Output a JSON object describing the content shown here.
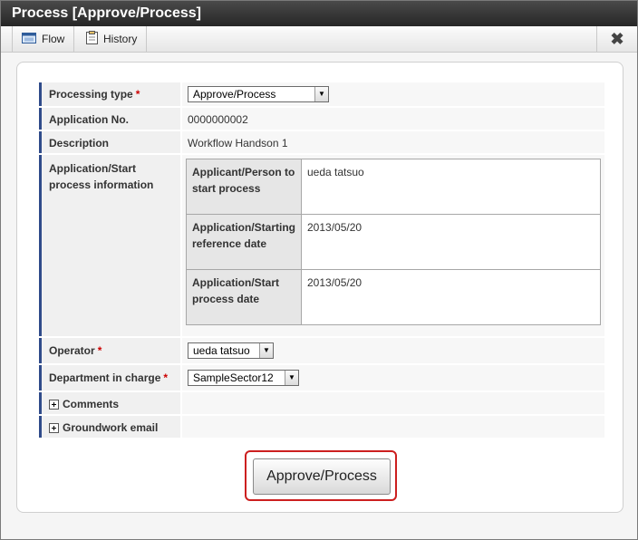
{
  "window": {
    "title": "Process  [Approve/Process]"
  },
  "toolbar": {
    "flow_label": "Flow",
    "history_label": "History",
    "close_glyph": "✖"
  },
  "form": {
    "processing_type": {
      "label": "Processing type",
      "required": "*",
      "value": "Approve/Process"
    },
    "application_no": {
      "label": "Application No.",
      "value": "0000000002"
    },
    "description": {
      "label": "Description",
      "value": "Workflow Handson 1"
    },
    "start_info": {
      "label": "Application/Start process information",
      "rows": [
        {
          "header": "Applicant/Person to start process",
          "value": "ueda tatsuo"
        },
        {
          "header": "Application/Starting reference date",
          "value": "2013/05/20"
        },
        {
          "header": "Application/Start process date",
          "value": "2013/05/20"
        }
      ]
    },
    "operator": {
      "label": "Operator",
      "required": "*",
      "value": "ueda tatsuo"
    },
    "department": {
      "label": "Department in charge",
      "required": "*",
      "value": "SampleSector12"
    },
    "comments": {
      "label": "Comments"
    },
    "groundwork_email": {
      "label": "Groundwork email"
    }
  },
  "actions": {
    "approve_label": "Approve/Process"
  },
  "icons": {
    "flow": "flow-icon",
    "history": "clipboard-icon",
    "close": "close-icon",
    "expand": "plus-icon",
    "dropdown": "chevron-down-icon"
  },
  "colors": {
    "title_bar": "#2e2e2e",
    "label_accent": "#2f4b8a",
    "required": "#cc0000",
    "highlight_border": "#cc1f1f"
  }
}
